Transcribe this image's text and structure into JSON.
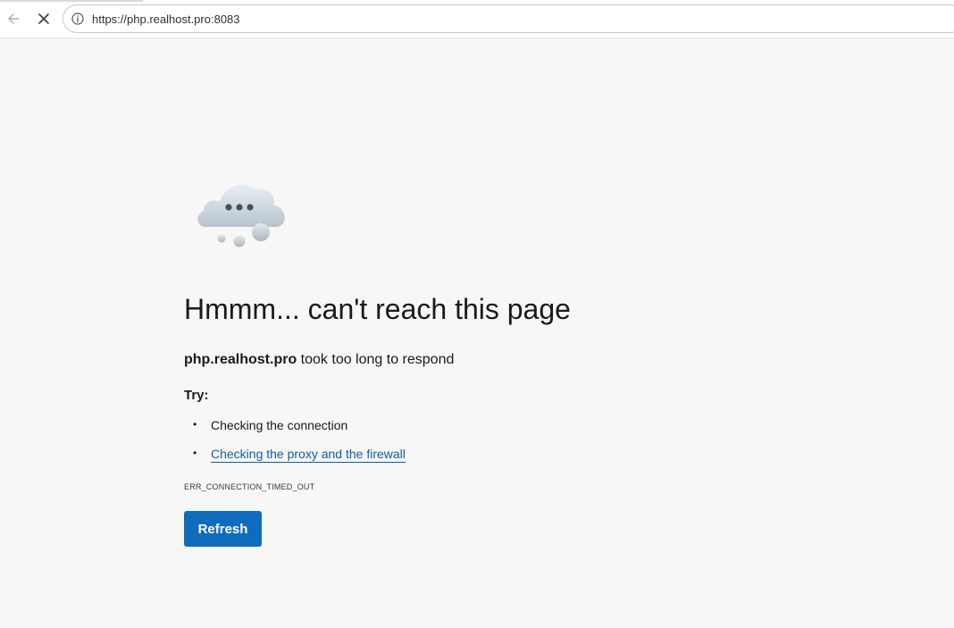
{
  "browser": {
    "url": "https://php.realhost.pro:8083",
    "back_icon": "arrow-left-icon",
    "stop_icon": "close-icon",
    "site_info_icon": "info-icon"
  },
  "error_page": {
    "illustration": "cloud-icon",
    "title": "Hmmm... can't reach this page",
    "host": "php.realhost.pro",
    "message": " took too long to respond",
    "try_label": "Try:",
    "suggestions": [
      {
        "text": "Checking the connection"
      },
      {
        "text": "Checking the proxy and the firewall"
      }
    ],
    "error_code": "ERR_CONNECTION_TIMED_OUT",
    "refresh_label": "Refresh"
  },
  "colors": {
    "page_background": "#f7f7f7",
    "accent": "#0f6cbd",
    "link": "#0f5d9c"
  }
}
